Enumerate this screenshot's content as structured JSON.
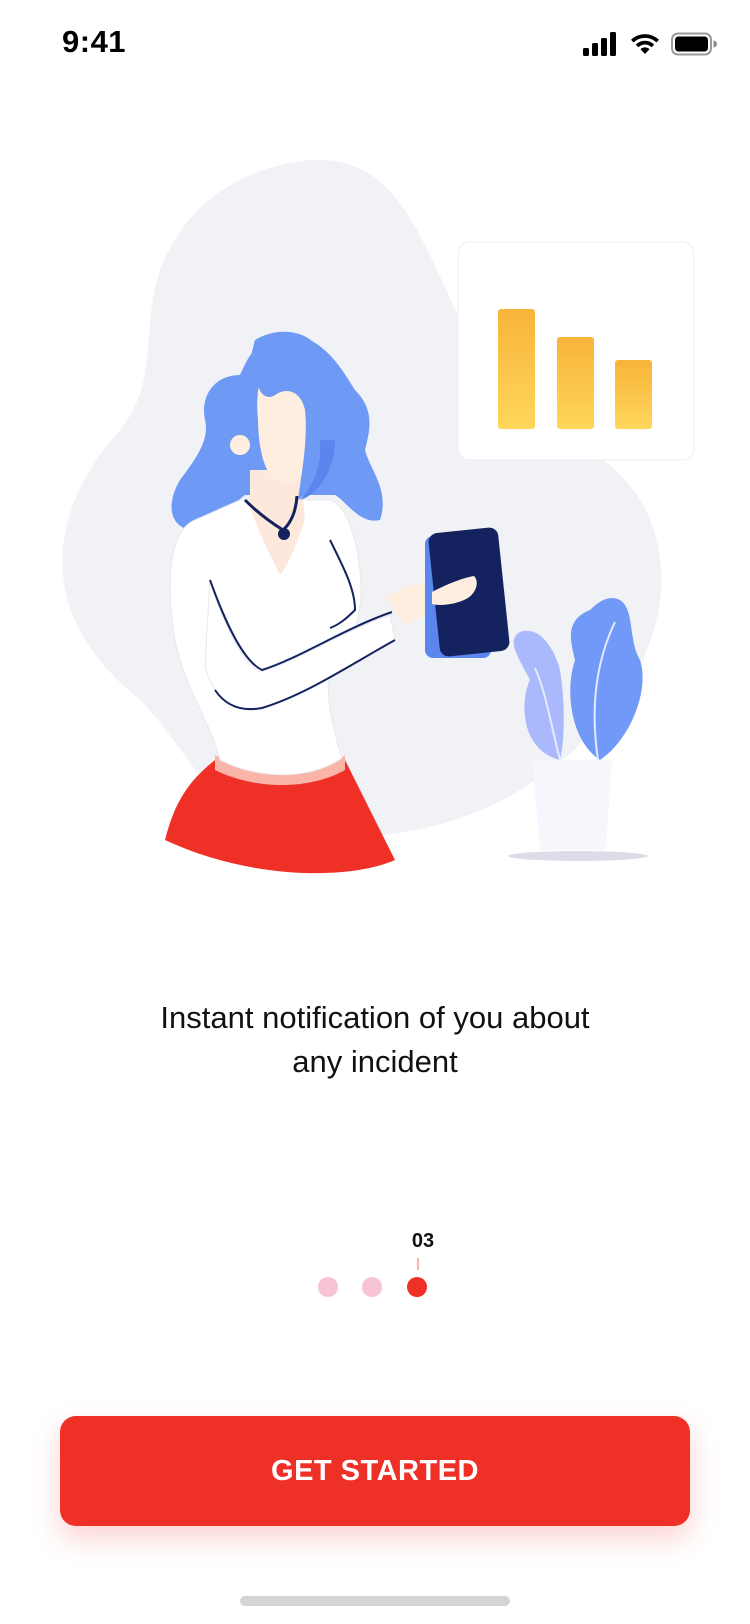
{
  "status_bar": {
    "time": "9:41",
    "icons": [
      "cellular-signal-icon",
      "wifi-icon",
      "battery-icon"
    ]
  },
  "illustration": {
    "subject": "woman holding a tablet beside a potted plant and a bar chart card",
    "bar_card_values": [
      100,
      74,
      54
    ]
  },
  "onboarding": {
    "caption_line1": "Instant notification of you about",
    "caption_line2": "any incident",
    "page_number": "03",
    "total_pages": 3,
    "current_page": 3
  },
  "cta": {
    "label": "GET STARTED"
  },
  "colors": {
    "accent": "#ee3026",
    "dot_inactive": "#f8c4d4",
    "hair": "#6e9af6",
    "tablet": "#14235f",
    "chart_bar": "#fbc64a"
  }
}
